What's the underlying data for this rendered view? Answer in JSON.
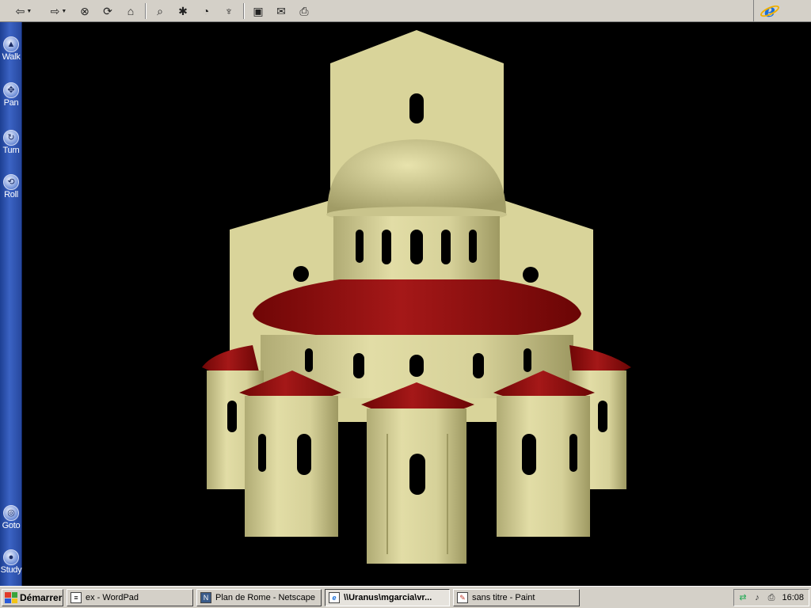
{
  "toolbar": {
    "buttons": [
      {
        "name": "back-button",
        "icon": "arrow-left-icon",
        "glyph": "⇦"
      },
      {
        "name": "forward-button",
        "icon": "arrow-right-icon",
        "glyph": "⇨"
      },
      {
        "name": "stop-button",
        "icon": "stop-icon",
        "glyph": "⊗"
      },
      {
        "name": "refresh-button",
        "icon": "refresh-icon",
        "glyph": "⟳"
      },
      {
        "name": "home-button",
        "icon": "home-icon",
        "glyph": "⌂"
      },
      {
        "name": "search-button",
        "icon": "search-icon",
        "glyph": "⌕"
      },
      {
        "name": "favorites-button",
        "icon": "favorites-icon",
        "glyph": "✱"
      },
      {
        "name": "history-button",
        "icon": "history-icon",
        "glyph": "◔"
      },
      {
        "name": "channels-button",
        "icon": "channels-icon",
        "glyph": "♆"
      },
      {
        "name": "fullscreen-button",
        "icon": "fullscreen-icon",
        "glyph": "▣"
      },
      {
        "name": "mail-button",
        "icon": "mail-icon",
        "glyph": "✉"
      },
      {
        "name": "print-button",
        "icon": "printer-icon",
        "glyph": "⎙"
      }
    ]
  },
  "nav": {
    "items": [
      {
        "label": "Walk",
        "icon": "walk-icon"
      },
      {
        "label": "Pan",
        "icon": "pan-icon"
      },
      {
        "label": "Turn",
        "icon": "turn-icon"
      },
      {
        "label": "Roll",
        "icon": "roll-icon"
      },
      {
        "label": "Goto",
        "icon": "goto-icon"
      },
      {
        "label": "Study",
        "icon": "study-icon"
      }
    ]
  },
  "scene": {
    "colors": {
      "background": "#000000",
      "stone": "#d9d49a",
      "stone_shade": "#a9a46c",
      "roof": "#8a0a0a",
      "roof_light": "#a51c1c"
    }
  },
  "taskbar": {
    "start_label": "Démarrer",
    "tasks": [
      {
        "label": "ex - WordPad",
        "icon": "wordpad-icon"
      },
      {
        "label": "Plan de Rome - Netscape",
        "icon": "netscape-icon"
      },
      {
        "label": "\\\\Uranus\\mgarcia\\vr...",
        "icon": "ie-icon"
      },
      {
        "label": "sans titre - Paint",
        "icon": "paint-icon"
      }
    ],
    "clock": "16:08"
  }
}
